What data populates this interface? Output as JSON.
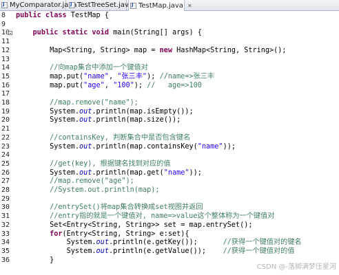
{
  "tabs": [
    {
      "label": "MyComparator.java",
      "active": false
    },
    {
      "label": "TestTreeSet.java",
      "active": false
    },
    {
      "label": "TestMap.java",
      "active": true
    }
  ],
  "lines": [
    {
      "n": "8",
      "fold": false,
      "toks": [
        [
          "kw",
          "public class "
        ],
        [
          "",
          "TestMap {"
        ]
      ]
    },
    {
      "n": "9",
      "fold": false,
      "toks": []
    },
    {
      "n": "10",
      "fold": true,
      "toks": [
        [
          "",
          "    "
        ],
        [
          "kw",
          "public static void "
        ],
        [
          "",
          "main(String[] args) {"
        ]
      ]
    },
    {
      "n": "11",
      "fold": false,
      "toks": []
    },
    {
      "n": "12",
      "fold": false,
      "toks": [
        [
          "",
          "        Map<String, String> map = "
        ],
        [
          "kw",
          "new "
        ],
        [
          "",
          "HashMap<String, String>();"
        ]
      ]
    },
    {
      "n": "13",
      "fold": false,
      "toks": []
    },
    {
      "n": "14",
      "fold": false,
      "toks": [
        [
          "",
          "        "
        ],
        [
          "cm",
          "//向map集合中添加一个键值对"
        ]
      ]
    },
    {
      "n": "15",
      "fold": false,
      "toks": [
        [
          "",
          "        map.put("
        ],
        [
          "str",
          "\"name\""
        ],
        [
          "",
          ", "
        ],
        [
          "str",
          "\"张三丰\""
        ],
        [
          "",
          "); "
        ],
        [
          "cm",
          "//name=>张三丰"
        ]
      ]
    },
    {
      "n": "16",
      "fold": false,
      "toks": [
        [
          "",
          "        map.put("
        ],
        [
          "str",
          "\"age\""
        ],
        [
          "",
          ", "
        ],
        [
          "str",
          "\"100\""
        ],
        [
          "",
          "); "
        ],
        [
          "cm",
          "//   age=>100"
        ]
      ]
    },
    {
      "n": "17",
      "fold": false,
      "toks": []
    },
    {
      "n": "18",
      "fold": false,
      "toks": [
        [
          "",
          "        "
        ],
        [
          "cm",
          "//map.remove(\"name\");"
        ]
      ]
    },
    {
      "n": "19",
      "fold": false,
      "toks": [
        [
          "",
          "        System."
        ],
        [
          "fld",
          "out"
        ],
        [
          "",
          ".println(map.isEmpty());"
        ]
      ]
    },
    {
      "n": "20",
      "fold": false,
      "toks": [
        [
          "",
          "        System."
        ],
        [
          "fld",
          "out"
        ],
        [
          "",
          ".println(map.size());"
        ]
      ]
    },
    {
      "n": "21",
      "fold": false,
      "toks": []
    },
    {
      "n": "22",
      "fold": false,
      "toks": [
        [
          "",
          "        "
        ],
        [
          "cm",
          "//containsKey, 判断集合中是否包含键名"
        ]
      ]
    },
    {
      "n": "23",
      "fold": false,
      "toks": [
        [
          "",
          "        System."
        ],
        [
          "fld",
          "out"
        ],
        [
          "",
          ".println(map.containsKey("
        ],
        [
          "str",
          "\"name\""
        ],
        [
          "",
          "));"
        ]
      ]
    },
    {
      "n": "24",
      "fold": false,
      "toks": []
    },
    {
      "n": "25",
      "fold": false,
      "toks": [
        [
          "",
          "        "
        ],
        [
          "cm",
          "//get(key), 根据键名找到对应的值"
        ]
      ]
    },
    {
      "n": "26",
      "fold": false,
      "toks": [
        [
          "",
          "        System."
        ],
        [
          "fld",
          "out"
        ],
        [
          "",
          ".println(map.get("
        ],
        [
          "str",
          "\"name\""
        ],
        [
          "",
          "));"
        ]
      ]
    },
    {
      "n": "27",
      "fold": false,
      "toks": [
        [
          "",
          "        "
        ],
        [
          "cm",
          "//map.remove(\"age\");"
        ]
      ]
    },
    {
      "n": "28",
      "fold": false,
      "toks": [
        [
          "",
          "        "
        ],
        [
          "cm",
          "//System.out.println(map);"
        ]
      ]
    },
    {
      "n": "29",
      "fold": false,
      "toks": []
    },
    {
      "n": "30",
      "fold": false,
      "toks": [
        [
          "",
          "        "
        ],
        [
          "cm",
          "//entrySet()将map集合转换成set视图并返回"
        ]
      ]
    },
    {
      "n": "31",
      "fold": false,
      "toks": [
        [
          "",
          "        "
        ],
        [
          "cm",
          "//entry指的就是一个键值对, name=>value这个整体称为一个键值对"
        ]
      ]
    },
    {
      "n": "32",
      "fold": false,
      "toks": [
        [
          "",
          "        Set<Entry<String, String>> set = map.entrySet();"
        ]
      ]
    },
    {
      "n": "33",
      "fold": false,
      "toks": [
        [
          "",
          "        "
        ],
        [
          "kw",
          "for"
        ],
        [
          "",
          "(Entry<String, String> e:set){"
        ]
      ]
    },
    {
      "n": "34",
      "fold": false,
      "toks": [
        [
          "",
          "            System."
        ],
        [
          "fld",
          "out"
        ],
        [
          "",
          ".println(e.getKey());      "
        ],
        [
          "cm",
          "//获得一个键值对的键名"
        ]
      ]
    },
    {
      "n": "35",
      "fold": false,
      "toks": [
        [
          "",
          "            System."
        ],
        [
          "fld",
          "out"
        ],
        [
          "",
          ".println(e.getValue());    "
        ],
        [
          "cm",
          "//获得一个键值对的值"
        ]
      ]
    },
    {
      "n": "36",
      "fold": false,
      "toks": [
        [
          "",
          "        }"
        ]
      ]
    }
  ],
  "watermark": "CSDN @-落脚满梦压星河"
}
